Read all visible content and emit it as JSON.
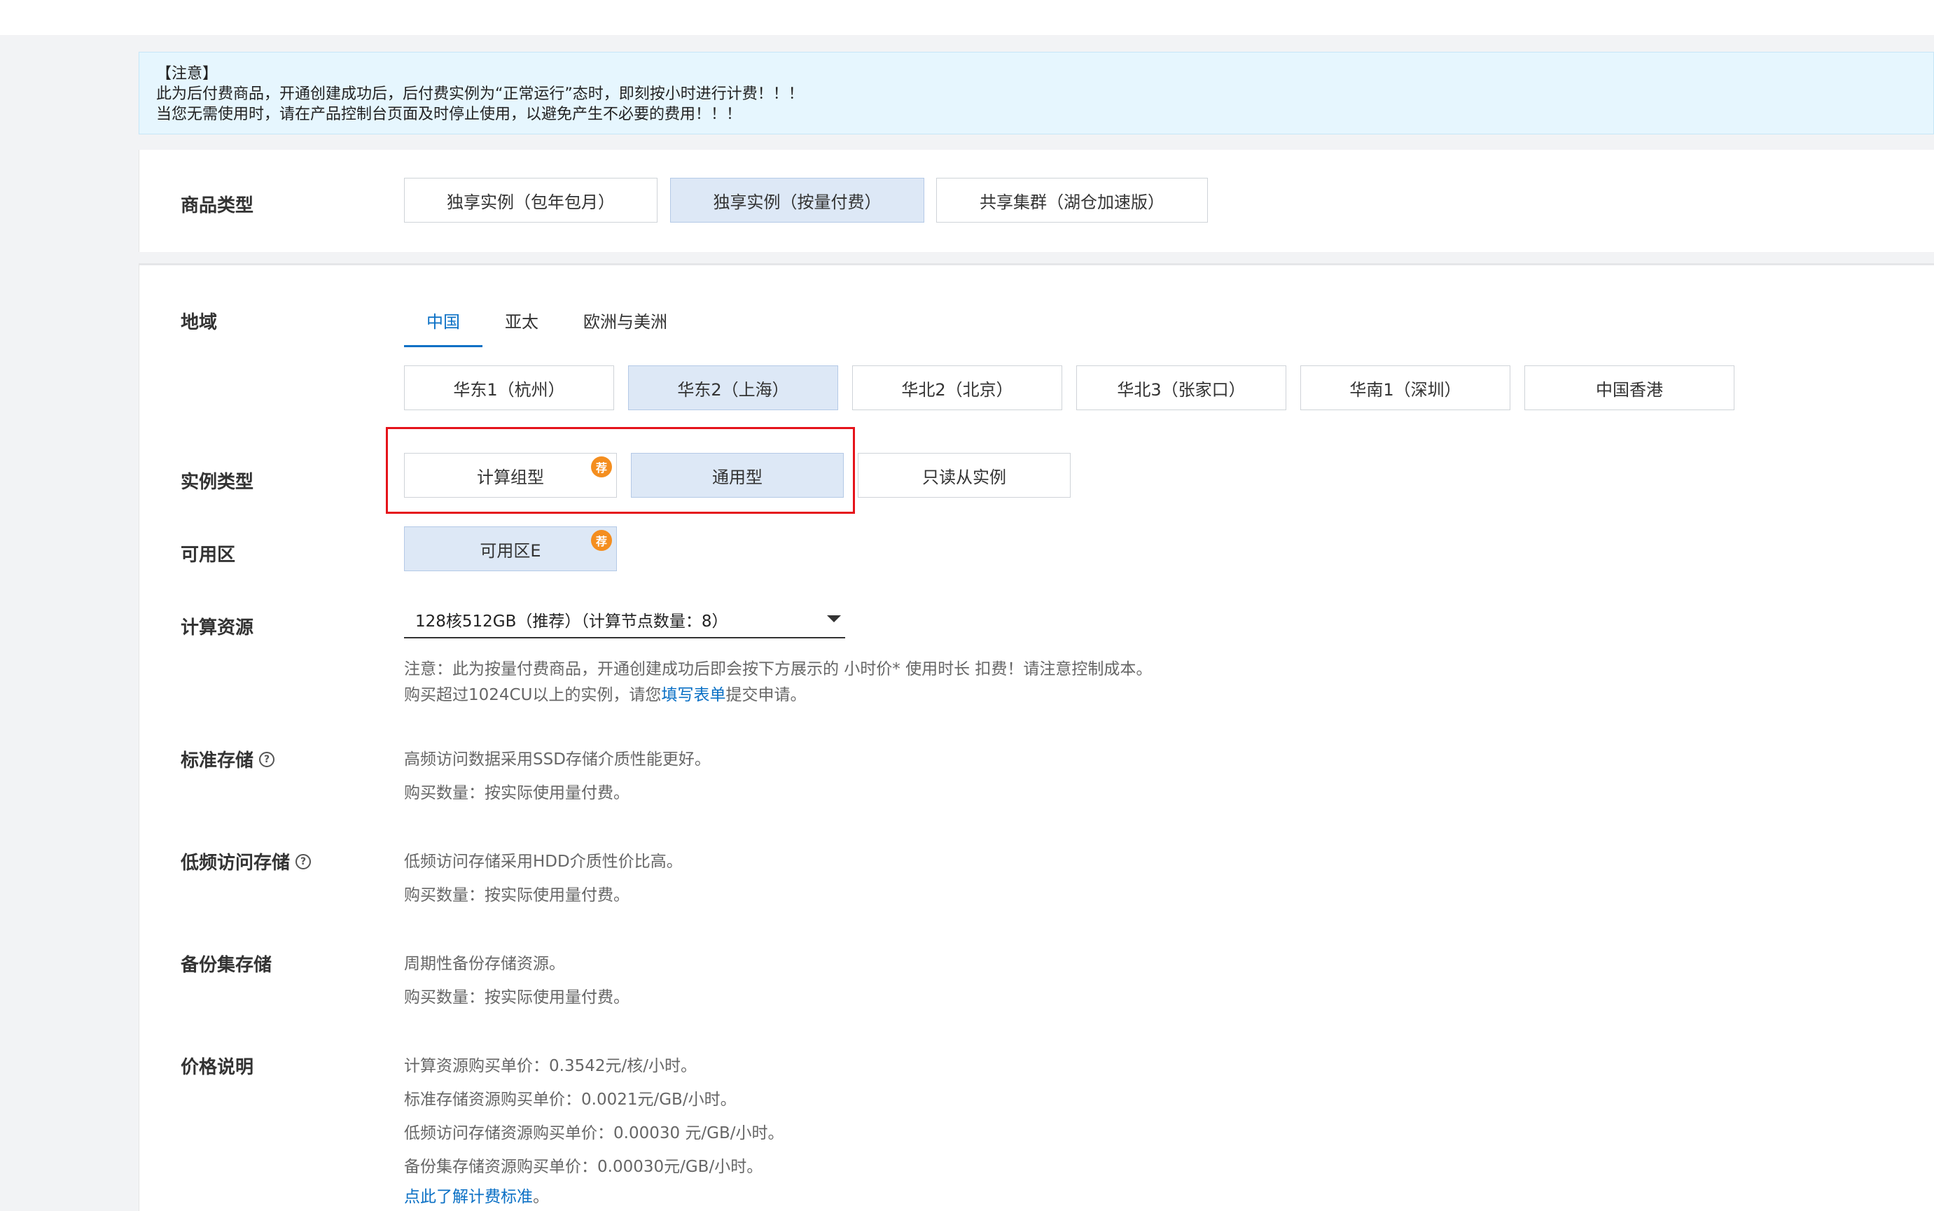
{
  "notice": {
    "line1": "【注意】",
    "line2": "此为后付费商品，开通创建成功后，后付费实例为“正常运行”态时，即刻按小时进行计费！！！",
    "line3": "当您无需使用时，请在产品控制台页面及时停止使用，以避免产生不必要的费用！！！"
  },
  "product_type": {
    "label": "商品类型",
    "options": [
      "独享实例（包年包月）",
      "独享实例（按量付费）",
      "共享集群（湖仓加速版）"
    ],
    "selected": "独享实例（按量付费）"
  },
  "region": {
    "label": "地域",
    "tabs": [
      "中国",
      "亚太",
      "欧洲与美洲"
    ],
    "active_tab": "中国",
    "options": [
      "华东1（杭州）",
      "华东2（上海）",
      "华北2（北京）",
      "华北3（张家口）",
      "华南1（深圳）",
      "中国香港"
    ],
    "selected": "华东2（上海）"
  },
  "instance_type": {
    "label": "实例类型",
    "options": [
      "计算组型",
      "通用型",
      "只读从实例"
    ],
    "selected": "通用型",
    "badge": "荐"
  },
  "zone": {
    "label": "可用区",
    "options": [
      "可用区E"
    ],
    "selected": "可用区E",
    "badge": "荐"
  },
  "compute": {
    "label": "计算资源",
    "value": "128核512GB（推荐）（计算节点数量：8）",
    "note1": "注意：此为按量付费商品，开通创建成功后即会按下方展示的 小时价* 使用时长 扣费！请注意控制成本。",
    "note2_prefix": "购买超过1024CU以上的实例，请您",
    "note2_link": "填写表单",
    "note2_suffix": "提交申请。"
  },
  "std_storage": {
    "label": "标准存储",
    "desc": "高频访问数据采用SSD存储介质性能更好。",
    "qty": "购买数量：按实际使用量付费。"
  },
  "low_storage": {
    "label": "低频访问存储",
    "desc": "低频访问存储采用HDD介质性价比高。",
    "qty": "购买数量：按实际使用量付费。"
  },
  "backup_storage": {
    "label": "备份集存储",
    "desc": "周期性备份存储资源。",
    "qty": "购买数量：按实际使用量付费。"
  },
  "price": {
    "label": "价格说明",
    "lines": [
      "计算资源购买单价：0.3542元/核/小时。",
      "标准存储资源购买单价：0.0021元/GB/小时。",
      "低频访问存储资源购买单价：0.00030 元/GB/小时。",
      "备份集存储资源购买单价：0.00030元/GB/小时。"
    ],
    "link": "点此了解计费标准",
    "link_suffix": "。"
  }
}
